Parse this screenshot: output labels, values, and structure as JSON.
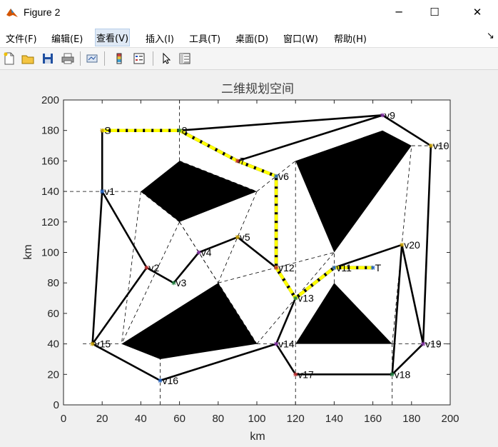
{
  "window": {
    "title": "Figure 2",
    "minimize_glyph": "─",
    "maximize_glyph": "☐",
    "close_glyph": "✕",
    "dock_glyph": "↘"
  },
  "menu": [
    {
      "label": "文件(F)"
    },
    {
      "label": "编辑(E)"
    },
    {
      "label": "查看(V)"
    },
    {
      "label": "插入(I)"
    },
    {
      "label": "工具(T)"
    },
    {
      "label": "桌面(D)"
    },
    {
      "label": "窗口(W)"
    },
    {
      "label": "帮助(H)"
    }
  ],
  "toolbar": {
    "icons": [
      "new-figure-icon",
      "open-file-icon",
      "save-icon",
      "print-icon",
      "link-plot-icon",
      "colorbar-icon",
      "legend-icon",
      "pointer-icon",
      "property-inspector-icon"
    ]
  },
  "colors": {
    "path": "#ffff00",
    "edge": "#000000",
    "obstacle": "#000000",
    "axis": "#262626",
    "title": "#404040"
  },
  "chart_data": {
    "type": "scatter",
    "title": "二维规划空间",
    "xlabel": "km",
    "ylabel": "km",
    "xlim": [
      0,
      200
    ],
    "ylim": [
      0,
      200
    ],
    "xticks": [
      0,
      20,
      40,
      60,
      80,
      100,
      120,
      140,
      160,
      180,
      200
    ],
    "yticks": [
      0,
      20,
      40,
      60,
      80,
      100,
      120,
      140,
      160,
      180,
      200
    ],
    "grid": false,
    "legend": "none",
    "obstacles": [
      [
        [
          40,
          140
        ],
        [
          60,
          160
        ],
        [
          100,
          140
        ],
        [
          60,
          120
        ]
      ],
      [
        [
          120,
          160
        ],
        [
          165,
          180
        ],
        [
          180,
          170
        ],
        [
          140,
          100
        ]
      ],
      [
        [
          30,
          40
        ],
        [
          80,
          80
        ],
        [
          100,
          40
        ],
        [
          50,
          30
        ]
      ],
      [
        [
          120,
          40
        ],
        [
          140,
          80
        ],
        [
          170,
          40
        ]
      ]
    ],
    "vertices": [
      {
        "name": "S",
        "x": 20,
        "y": 180,
        "label": "S"
      },
      {
        "name": "v1",
        "x": 20,
        "y": 140,
        "label": "v1"
      },
      {
        "name": "v2",
        "x": 43,
        "y": 90,
        "label": "v2"
      },
      {
        "name": "v3",
        "x": 57,
        "y": 80,
        "label": "v3"
      },
      {
        "name": "v4",
        "x": 70,
        "y": 100,
        "label": "v4"
      },
      {
        "name": "v5",
        "x": 90,
        "y": 110,
        "label": "v5"
      },
      {
        "name": "v6",
        "x": 110,
        "y": 150,
        "label": "v6"
      },
      {
        "name": "v7",
        "x": 90,
        "y": 160,
        "label": "7"
      },
      {
        "name": "v8",
        "x": 60,
        "y": 180,
        "label": "8"
      },
      {
        "name": "v9",
        "x": 165,
        "y": 190,
        "label": "v9"
      },
      {
        "name": "v10",
        "x": 190,
        "y": 170,
        "label": "v10"
      },
      {
        "name": "v11",
        "x": 140,
        "y": 90,
        "label": "v11"
      },
      {
        "name": "v12",
        "x": 110,
        "y": 90,
        "label": "v12"
      },
      {
        "name": "v13",
        "x": 120,
        "y": 70,
        "label": "v13"
      },
      {
        "name": "v14",
        "x": 110,
        "y": 40,
        "label": "v14"
      },
      {
        "name": "v15",
        "x": 15,
        "y": 40,
        "label": "v15"
      },
      {
        "name": "v16",
        "x": 50,
        "y": 16,
        "label": "v16"
      },
      {
        "name": "v17",
        "x": 120,
        "y": 20,
        "label": "v17"
      },
      {
        "name": "v18",
        "x": 170,
        "y": 20,
        "label": "v18"
      },
      {
        "name": "v19",
        "x": 186,
        "y": 40,
        "label": "v19"
      },
      {
        "name": "v20",
        "x": 175,
        "y": 105,
        "label": "v20"
      },
      {
        "name": "T",
        "x": 160,
        "y": 90,
        "label": "T"
      }
    ],
    "edges": [
      [
        "S",
        "v1"
      ],
      [
        "S",
        "v8"
      ],
      [
        "v8",
        "v9"
      ],
      [
        "v9",
        "v10"
      ],
      [
        "v10",
        "v19"
      ],
      [
        "v19",
        "v20"
      ],
      [
        "v19",
        "v18"
      ],
      [
        "v18",
        "v17"
      ],
      [
        "v17",
        "v14"
      ],
      [
        "v14",
        "v16"
      ],
      [
        "v16",
        "v15"
      ],
      [
        "v15",
        "v1"
      ],
      [
        "v15",
        "v2"
      ],
      [
        "v1",
        "v2"
      ],
      [
        "v2",
        "v3"
      ],
      [
        "v3",
        "v4"
      ],
      [
        "v4",
        "v5"
      ],
      [
        "v5",
        "v12"
      ],
      [
        "v12",
        "v6"
      ],
      [
        "v6",
        "v7"
      ],
      [
        "v7",
        "v9"
      ],
      [
        "v7",
        "v8"
      ],
      [
        "v12",
        "v13"
      ],
      [
        "v13",
        "v14"
      ],
      [
        "v13",
        "v11"
      ],
      [
        "v11",
        "v20"
      ],
      [
        "v11",
        "T"
      ],
      [
        "v20",
        "v18"
      ]
    ],
    "dashed_links": [
      [
        [
          0,
          140
        ],
        [
          40,
          140
        ]
      ],
      [
        [
          10,
          40
        ],
        [
          30,
          40
        ]
      ],
      [
        [
          170,
          40
        ],
        [
          200,
          40
        ]
      ],
      [
        [
          60,
          160
        ],
        [
          60,
          200
        ]
      ],
      [
        [
          50,
          0
        ],
        [
          50,
          30
        ]
      ],
      [
        [
          120,
          0
        ],
        [
          120,
          40
        ]
      ],
      [
        [
          170,
          0
        ],
        [
          170,
          40
        ]
      ],
      [
        [
          180,
          170
        ],
        [
          200,
          170
        ]
      ],
      [
        [
          40,
          140
        ],
        [
          30,
          40
        ]
      ],
      [
        [
          60,
          120
        ],
        [
          30,
          40
        ]
      ],
      [
        [
          60,
          120
        ],
        [
          80,
          80
        ]
      ],
      [
        [
          60,
          120
        ],
        [
          100,
          40
        ]
      ],
      [
        [
          60,
          120
        ],
        [
          40,
          140
        ]
      ],
      [
        [
          60,
          160
        ],
        [
          100,
          140
        ]
      ],
      [
        [
          100,
          140
        ],
        [
          80,
          80
        ]
      ],
      [
        [
          100,
          140
        ],
        [
          120,
          160
        ]
      ],
      [
        [
          120,
          160
        ],
        [
          120,
          40
        ]
      ],
      [
        [
          80,
          80
        ],
        [
          140,
          100
        ]
      ],
      [
        [
          100,
          40
        ],
        [
          140,
          100
        ]
      ],
      [
        [
          140,
          80
        ],
        [
          140,
          100
        ]
      ],
      [
        [
          170,
          40
        ],
        [
          180,
          170
        ]
      ],
      [
        [
          100,
          40
        ],
        [
          120,
          40
        ]
      ]
    ],
    "path": [
      [
        20,
        180
      ],
      [
        60,
        180
      ],
      [
        90,
        160
      ],
      [
        110,
        150
      ],
      [
        110,
        90
      ],
      [
        120,
        70
      ],
      [
        140,
        90
      ],
      [
        160,
        90
      ]
    ]
  }
}
